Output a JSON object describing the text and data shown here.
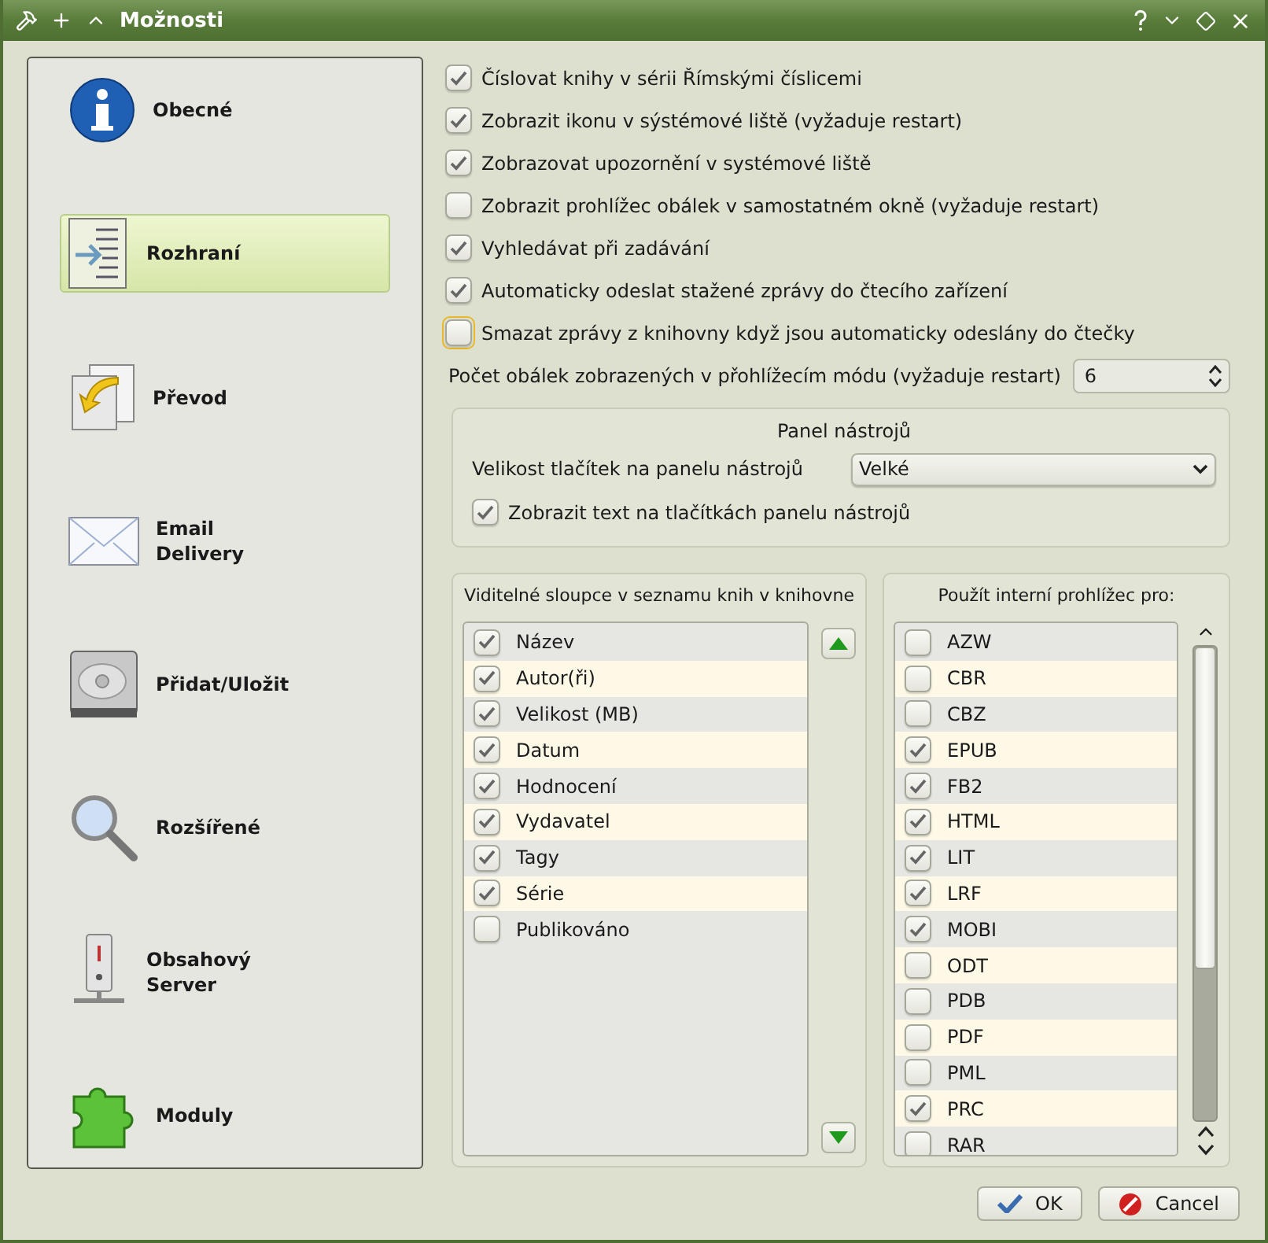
{
  "window": {
    "title": "Možnosti"
  },
  "sidebar": {
    "items": [
      {
        "label": "Obecné",
        "selected": false
      },
      {
        "label": "Rozhraní",
        "selected": true
      },
      {
        "label": "Převod",
        "selected": false
      },
      {
        "label": "Email Delivery",
        "selected": false
      },
      {
        "label": "Přidat/Uložit",
        "selected": false
      },
      {
        "label": "Rozšířené",
        "selected": false
      },
      {
        "label": "Obsahový Server",
        "selected": false
      },
      {
        "label": "Moduly",
        "selected": false
      }
    ]
  },
  "options": [
    {
      "label": "Číslovat knihy v sérii Římskými číslicemi",
      "checked": true,
      "focused": false
    },
    {
      "label": "Zobrazit ikonu v sýstémové liště (vyžaduje restart)",
      "checked": true,
      "focused": false
    },
    {
      "label": "Zobrazovat upozornění v systémové liště",
      "checked": true,
      "focused": false
    },
    {
      "label": "Zobrazit prohlížec obálek v samostatném okně (vyžaduje restart)",
      "checked": false,
      "focused": false
    },
    {
      "label": "Vyhledávat při zadávání",
      "checked": true,
      "focused": false
    },
    {
      "label": "Automaticky odeslat stažené zprávy do čtecího zařízení",
      "checked": true,
      "focused": false
    },
    {
      "label": "Smazat zprávy z knihovny když jsou automaticky odeslány do čtečky",
      "checked": false,
      "focused": true
    }
  ],
  "cover_count": {
    "label": "Počet obálek zobrazených v přohlížecím módu (vyžaduje restart)",
    "value": "6"
  },
  "toolbar_group": {
    "title": "Panel nástrojů",
    "size_label": "Velikost tlačítek na panelu nástrojů",
    "size_value": "Velké",
    "show_text": {
      "label": "Zobrazit text na tlačítkách panelu nástrojů",
      "checked": true
    }
  },
  "columns_group": {
    "title": "Viditelné sloupce v seznamu knih v knihovne",
    "items": [
      {
        "label": "Název",
        "checked": true
      },
      {
        "label": "Autor(ři)",
        "checked": true
      },
      {
        "label": "Velikost (MB)",
        "checked": true
      },
      {
        "label": "Datum",
        "checked": true
      },
      {
        "label": "Hodnocení",
        "checked": true
      },
      {
        "label": "Vydavatel",
        "checked": true
      },
      {
        "label": "Tagy",
        "checked": true
      },
      {
        "label": "Série",
        "checked": true
      },
      {
        "label": "Publikováno",
        "checked": false
      }
    ]
  },
  "viewer_group": {
    "title": "Použít interní prohlížec pro:",
    "items": [
      {
        "label": "AZW",
        "checked": false
      },
      {
        "label": "CBR",
        "checked": false
      },
      {
        "label": "CBZ",
        "checked": false
      },
      {
        "label": "EPUB",
        "checked": true
      },
      {
        "label": "FB2",
        "checked": true
      },
      {
        "label": "HTML",
        "checked": true
      },
      {
        "label": "LIT",
        "checked": true
      },
      {
        "label": "LRF",
        "checked": true
      },
      {
        "label": "MOBI",
        "checked": true
      },
      {
        "label": "ODT",
        "checked": false
      },
      {
        "label": "PDB",
        "checked": false
      },
      {
        "label": "PDF",
        "checked": false
      },
      {
        "label": "PML",
        "checked": false
      },
      {
        "label": "PRC",
        "checked": true
      },
      {
        "label": "RAR",
        "checked": false
      }
    ]
  },
  "buttons": [
    {
      "label": "OK",
      "kind": "ok"
    },
    {
      "label": "Cancel",
      "kind": "cancel"
    }
  ]
}
